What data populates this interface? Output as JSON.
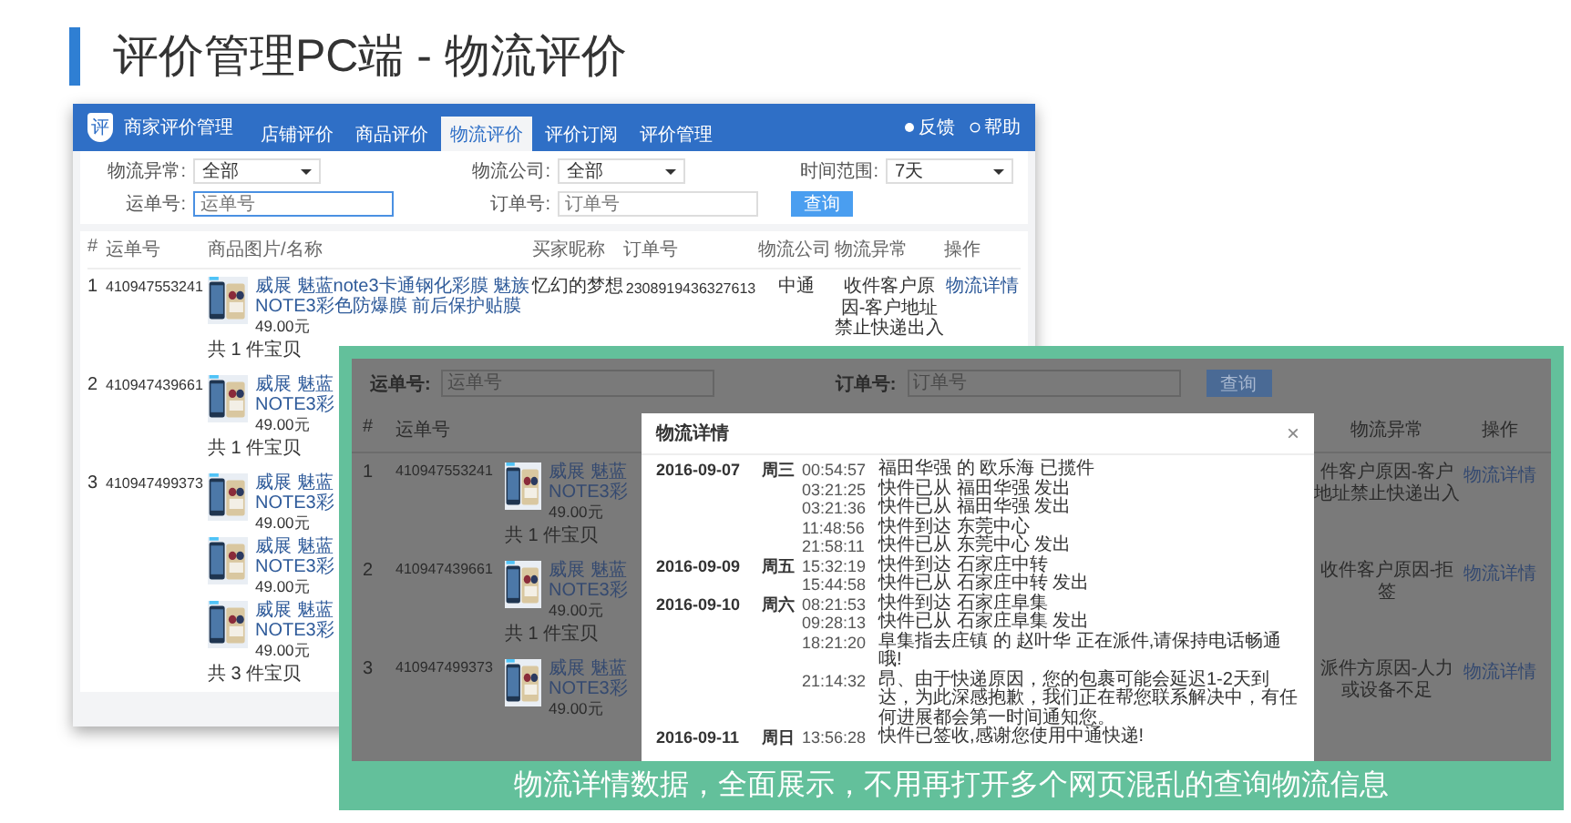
{
  "slide": {
    "title": "评价管理PC端 - 物流评价",
    "caption": "物流详情数据，全面展示，不用再打开多个网页混乱的查询物流信息"
  },
  "back_screen": {
    "logo_text": "评",
    "brand": "商家评价管理",
    "tabs": [
      {
        "label": "店铺评价",
        "selected": false
      },
      {
        "label": "商品评价",
        "selected": false
      },
      {
        "label": "物流评价",
        "selected": true
      },
      {
        "label": "评价订阅",
        "selected": false
      },
      {
        "label": "评价管理",
        "selected": false
      }
    ],
    "header_links": [
      {
        "kind": "feedback",
        "label": "反馈"
      },
      {
        "kind": "help",
        "label": "帮助"
      }
    ],
    "filter_rows": [
      [
        {
          "kind": "select",
          "label": "物流异常:",
          "value": "全部"
        },
        {
          "kind": "select",
          "label": "物流公司:",
          "value": "全部"
        },
        {
          "kind": "select",
          "label": "时间范围:",
          "value": "7天"
        }
      ],
      [
        {
          "kind": "input",
          "label": "运单号:",
          "placeholder": "运单号",
          "focused": true
        },
        {
          "kind": "input",
          "label": "订单号:",
          "placeholder": "订单号",
          "focused": false
        },
        {
          "kind": "button",
          "label": "查询"
        }
      ]
    ],
    "columns": [
      "#",
      "运单号",
      "商品图片/名称",
      "买家昵称",
      "订单号",
      "物流公司",
      "物流异常",
      "操作"
    ],
    "rows": [
      {
        "number": "1",
        "waybill": "410947553241",
        "items": [
          {
            "name_lines": [
              "威展 魅蓝note3卡通钢化彩膜 魅族",
              "NOTE3彩色防爆膜 前后保护贴膜"
            ],
            "price": "49.00元"
          }
        ],
        "count": "共 1 件宝贝",
        "buyer": "忆幻的梦想",
        "order": "2308919436327613",
        "carrier": "中通",
        "anomaly": "收件客户原因-客户地址禁止快递出入",
        "action": "物流详情"
      },
      {
        "number": "2",
        "waybill": "410947439661",
        "items": [
          {
            "name_lines": [
              "威展 魅蓝",
              "NOTE3彩"
            ],
            "price": "49.00元"
          }
        ],
        "count": "共 1 件宝贝"
      },
      {
        "number": "3",
        "waybill": "410947499373",
        "items": [
          {
            "name_lines": [
              "威展 魅蓝",
              "NOTE3彩"
            ],
            "price": "49.00元"
          },
          {
            "name_lines": [
              "威展 魅蓝",
              "NOTE3彩"
            ],
            "price": "49.00元"
          },
          {
            "name_lines": [
              "威展 魅蓝",
              "NOTE3彩"
            ],
            "price": "49.00元"
          }
        ],
        "count": "共 3 件宝贝"
      }
    ]
  },
  "front_screen": {
    "filter_fields": [
      {
        "label": "运单号:",
        "placeholder": "运单号"
      },
      {
        "label": "订单号:",
        "placeholder": "订单号"
      }
    ],
    "button": "查询",
    "columns": [
      "#",
      "运单号",
      "物流异常",
      "操作"
    ],
    "rows": [
      {
        "number": "1",
        "waybill": "410947553241",
        "name_lines": [
          "威展 魅蓝",
          "NOTE3彩"
        ],
        "price": "49.00元",
        "count": "共 1 件宝贝",
        "anomaly": "件客户原因-客户地址禁止快递出入",
        "action": "物流详情"
      },
      {
        "number": "2",
        "waybill": "410947439661",
        "name_lines": [
          "威展 魅蓝",
          "NOTE3彩"
        ],
        "price": "49.00元",
        "count": "共 1 件宝贝",
        "anomaly": "收件客户原因-拒签",
        "action": "物流详情"
      },
      {
        "number": "3",
        "waybill": "410947499373",
        "name_lines": [
          "威展 魅蓝",
          "NOTE3彩"
        ],
        "price": "49.00元",
        "anomaly": "派件方原因-人力或设备不足",
        "action": "物流详情"
      }
    ]
  },
  "modal": {
    "title": "物流详情",
    "close": "×",
    "entries": [
      {
        "date": "2016-09-07",
        "weekday": "周三",
        "time": "00:54:57",
        "text": "福田华强 的 欧乐海 已揽件"
      },
      {
        "time": "03:21:25",
        "text": "快件已从 福田华强 发出"
      },
      {
        "time": "03:21:36",
        "text": "快件已从 福田华强 发出"
      },
      {
        "time": "11:48:56",
        "text": "快件到达 东莞中心"
      },
      {
        "time": "21:58:11",
        "text": "快件已从 东莞中心 发出"
      },
      {
        "date": "2016-09-09",
        "weekday": "周五",
        "time": "15:32:19",
        "text": "快件到达 石家庄中转"
      },
      {
        "time": "15:44:58",
        "text": "快件已从 石家庄中转 发出"
      },
      {
        "date": "2016-09-10",
        "weekday": "周六",
        "time": "08:21:53",
        "text": "快件到达 石家庄阜集"
      },
      {
        "time": "09:28:13",
        "text": "快件已从 石家庄阜集 发出"
      },
      {
        "time": "18:21:20",
        "text": "阜集指去庄镇 的 赵叶华 正在派件,请保持电话畅通哦!"
      },
      {
        "time": "21:14:32",
        "text": "昂、由于快递原因，您的包裹可能会延迟1-2天到达，为此深感抱歉，我们正在帮您联系解决中，有任何进展都会第一时间通知您。"
      },
      {
        "date": "2016-09-11",
        "weekday": "周日",
        "time": "13:56:28",
        "text": "快件已签收,感谢您使用中通快递!"
      }
    ]
  }
}
